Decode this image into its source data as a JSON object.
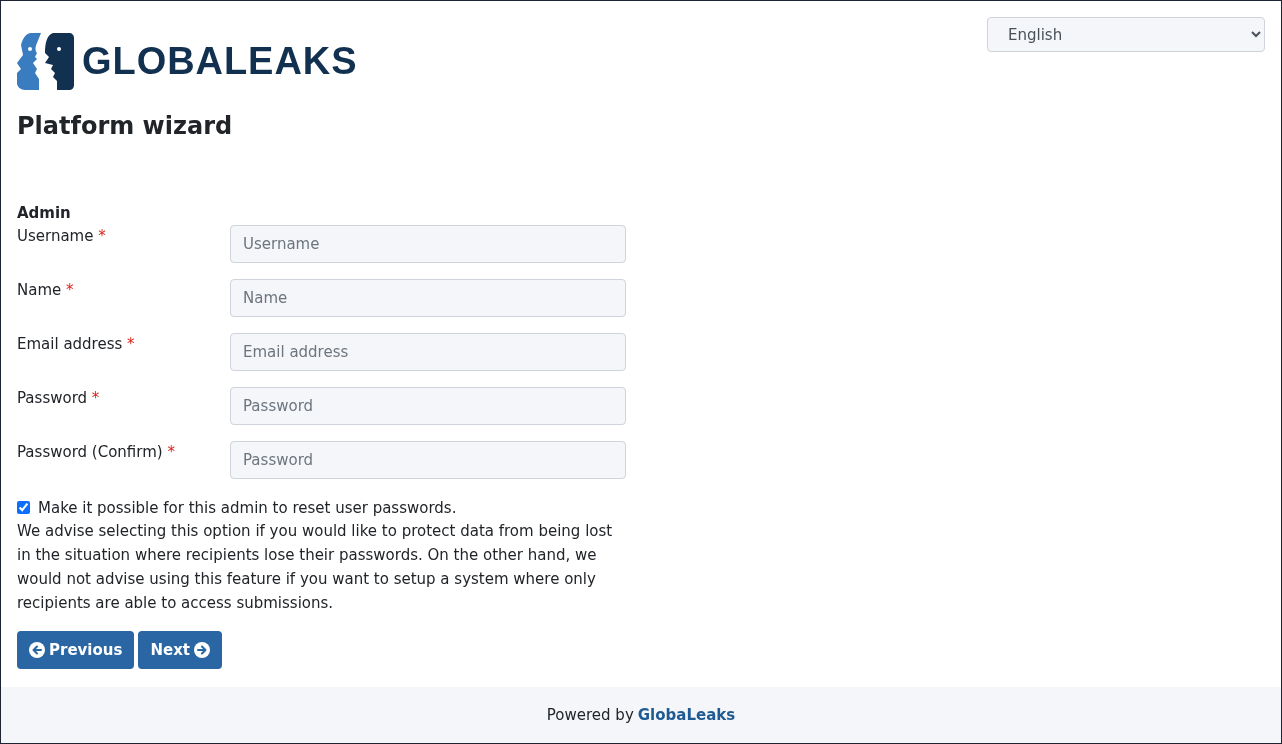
{
  "header": {
    "logo_text": "GLOBALEAKS",
    "language": "English"
  },
  "title": "Platform wizard",
  "section": "Admin",
  "fields": [
    {
      "label": "Username",
      "mark": "*",
      "placeholder": "Username"
    },
    {
      "label": "Name",
      "mark": "*",
      "placeholder": "Name"
    },
    {
      "label": "Email address",
      "mark": "*",
      "placeholder": "Email address"
    },
    {
      "label": "Password",
      "mark": "*",
      "placeholder": "Password"
    },
    {
      "label": "Password (Confirm)",
      "mark": "*",
      "placeholder": "Password"
    }
  ],
  "reset_option": {
    "label": "Make it possible for this admin to reset user passwords.",
    "checked": true
  },
  "advice": "We advise selecting this option if you would like to protect data from being lost in the situation where recipients lose their passwords. On the other hand, we would not advise using this feature if you want to setup a system where only recipients are able to access submissions.",
  "buttons": [
    {
      "kind": "previous",
      "label": "Previous"
    },
    {
      "kind": "next",
      "label": "Next"
    }
  ],
  "footer": {
    "text": "Powered by",
    "link": "GlobaLeaks"
  }
}
